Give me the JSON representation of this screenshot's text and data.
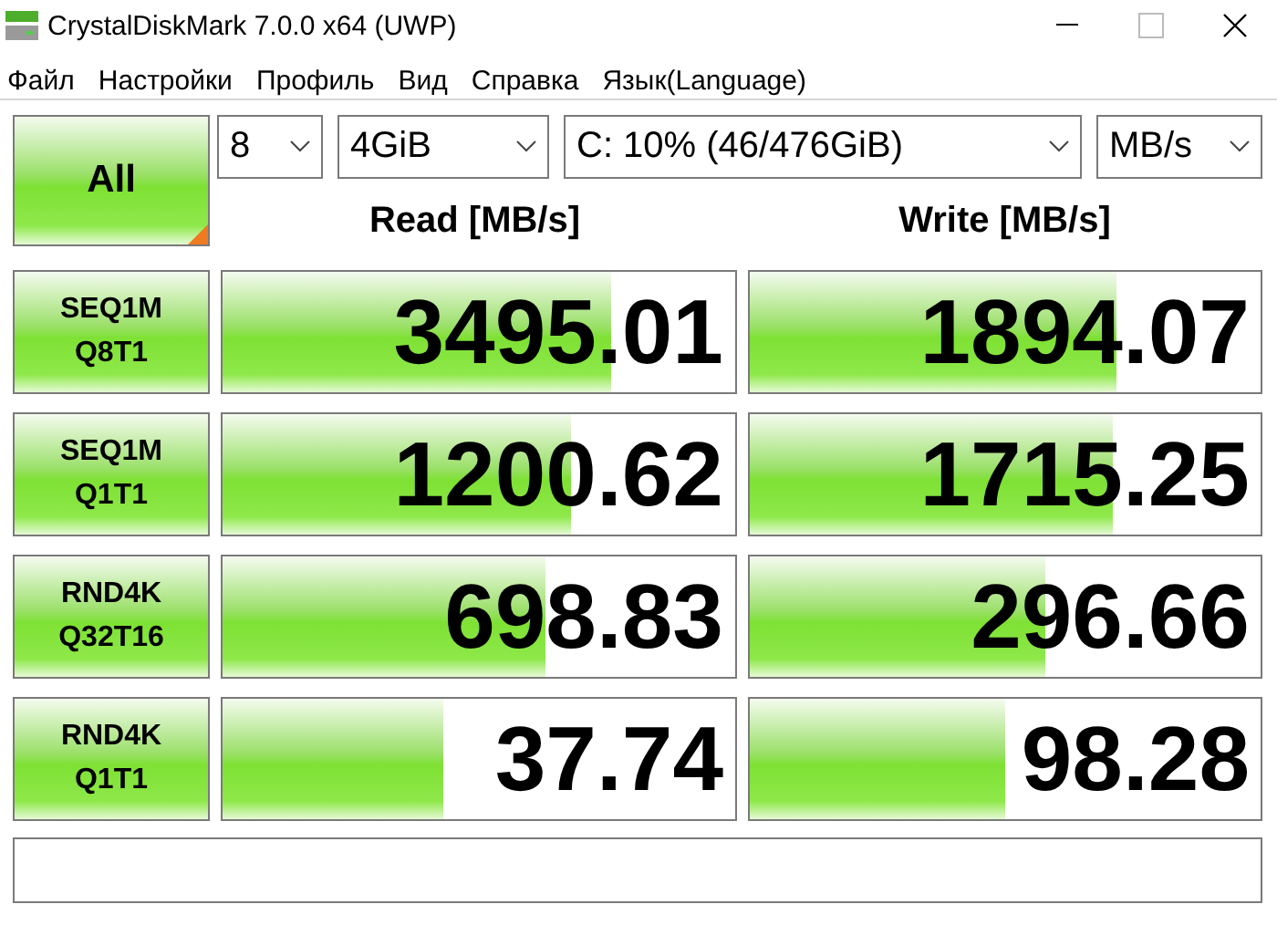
{
  "window": {
    "title": "CrystalDiskMark 7.0.0 x64 (UWP)"
  },
  "menu": [
    "Файл",
    "Настройки",
    "Профиль",
    "Вид",
    "Справка",
    "Язык(Language)"
  ],
  "all_button": "All",
  "selectors": [
    {
      "value": "8"
    },
    {
      "value": "4GiB"
    },
    {
      "value": "C: 10% (46/476GiB)"
    },
    {
      "value": "MB/s"
    }
  ],
  "columns": [
    "Read [MB/s]",
    "Write [MB/s]"
  ],
  "tests": [
    {
      "line1": "SEQ1M",
      "line2": "Q8T1",
      "read": {
        "value": "3495.01",
        "level": 0.76
      },
      "write": {
        "value": "1894.07",
        "level": 0.72
      }
    },
    {
      "line1": "SEQ1M",
      "line2": "Q1T1",
      "read": {
        "value": "1200.62",
        "level": 0.68
      },
      "write": {
        "value": "1715.25",
        "level": 0.71
      }
    },
    {
      "line1": "RND4K",
      "line2": "Q32T16",
      "read": {
        "value": "698.83",
        "level": 0.63
      },
      "write": {
        "value": "296.66",
        "level": 0.58
      }
    },
    {
      "line1": "RND4K",
      "line2": "Q1T1",
      "read": {
        "value": "37.74",
        "level": 0.43
      },
      "write": {
        "value": "98.28",
        "level": 0.5
      }
    }
  ]
}
